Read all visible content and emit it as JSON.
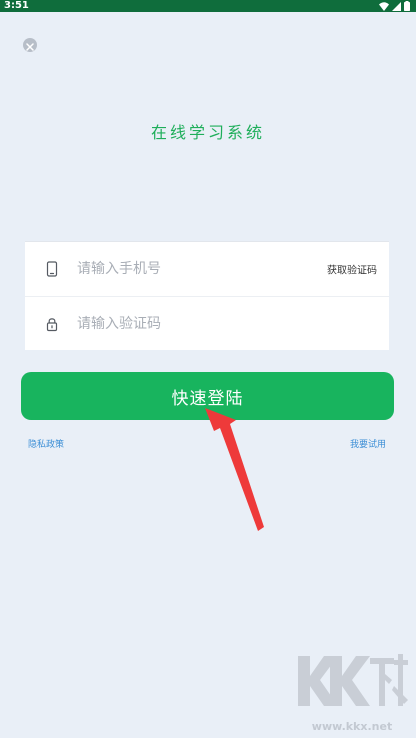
{
  "status_bar": {
    "time": "3:51",
    "icons": [
      "wifi-icon",
      "signal-icon",
      "battery-icon"
    ]
  },
  "close_icon": "close-icon",
  "app": {
    "title": "在线学习系统"
  },
  "form": {
    "phone": {
      "icon": "phone-icon",
      "value": "",
      "placeholder": "请输入手机号",
      "get_code_label": "获取验证码"
    },
    "code": {
      "icon": "lock-icon",
      "value": "",
      "placeholder": "请输入验证码"
    }
  },
  "login_button_label": "快速登陆",
  "links": {
    "privacy_label": "隐私政策",
    "free_trial_label": "我要试用"
  },
  "annotation": {
    "arrow_icon": "red-arrow-icon"
  },
  "watermark": {
    "logo_text": "KK下载",
    "url": "www.kkx.net"
  },
  "colors": {
    "status_bar": "#0f6d3c",
    "background": "#e9eff7",
    "brand_green": "#18b45e",
    "title_green": "#1eae5a",
    "link_blue": "#3d8fd6",
    "arrow_red": "#ee3a3a"
  }
}
